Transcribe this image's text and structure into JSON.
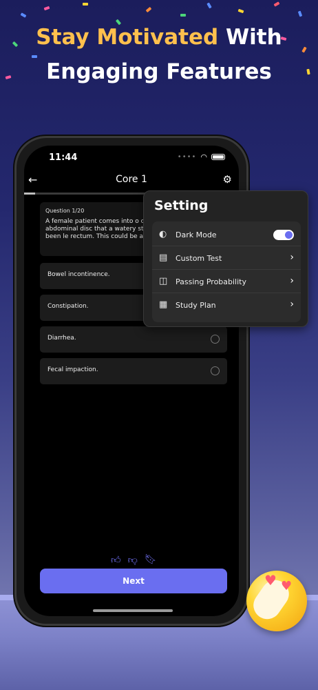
{
  "headline": {
    "accent": "Stay Motivated",
    "rest": " With",
    "line2": "Engaging Features"
  },
  "status_bar": {
    "time": "11:44"
  },
  "header": {
    "title": "Core 1"
  },
  "progress": {
    "fraction": 0.05
  },
  "question": {
    "number": "Question 1/20",
    "text": "A female patient comes into o complaints of abdominal disc that a watery stool has been le rectum. This could be a sign o"
  },
  "options": [
    {
      "label": "Bowel incontinence."
    },
    {
      "label": "Constipation."
    },
    {
      "label": "Diarrhea."
    },
    {
      "label": "Fecal impaction."
    }
  ],
  "actions": {
    "next_label": "Next"
  },
  "settings": {
    "title": "Setting",
    "items": [
      {
        "label": "Dark Mode",
        "icon": "dark-mode-icon",
        "toggle_on": true
      },
      {
        "label": "Custom Test",
        "icon": "custom-test-icon"
      },
      {
        "label": "Passing Probability",
        "icon": "chart-icon"
      },
      {
        "label": "Study Plan",
        "icon": "study-plan-icon"
      }
    ]
  },
  "colors": {
    "accent": "#6a6ef0",
    "headline_accent": "#ffc04d",
    "background": "#1b1d5c"
  }
}
